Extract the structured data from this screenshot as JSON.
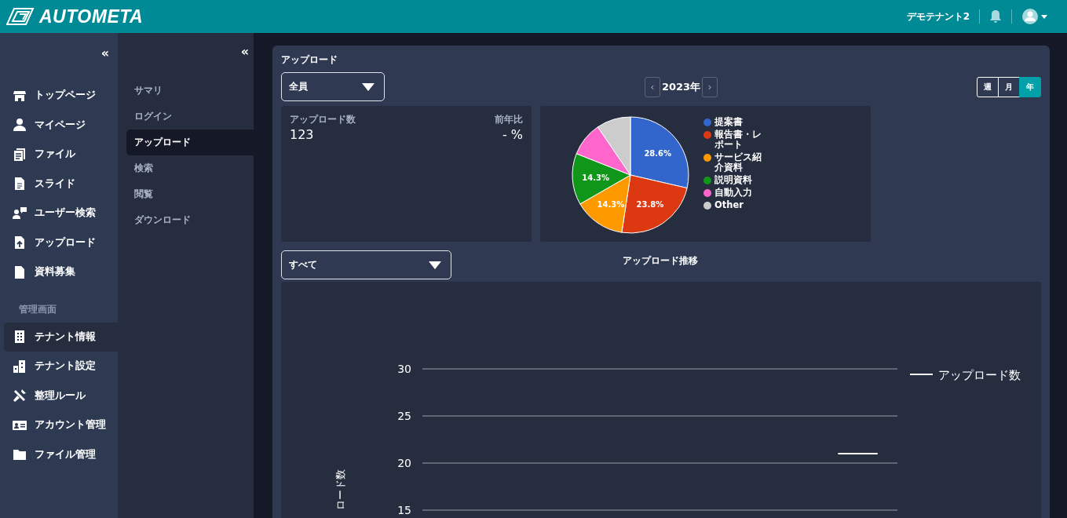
{
  "header": {
    "logo_text": "AUTOMETA",
    "tenant": "デモテナント2"
  },
  "sidebar": {
    "collapse": "«",
    "items": [
      {
        "label": "トップページ",
        "kind": "store",
        "selected": false
      },
      {
        "label": "マイページ",
        "kind": "person",
        "selected": false
      },
      {
        "label": "ファイル",
        "kind": "files",
        "selected": false
      },
      {
        "label": "スライド",
        "kind": "document",
        "selected": false
      },
      {
        "label": "ユーザー検索",
        "kind": "user-chat",
        "selected": false
      },
      {
        "label": "アップロード",
        "kind": "upload",
        "selected": false
      },
      {
        "label": "資料募集",
        "kind": "page",
        "selected": false
      }
    ],
    "section_label": "管理画面",
    "admin_items": [
      {
        "label": "テナント情報",
        "kind": "building",
        "selected": true
      },
      {
        "label": "テナント設定",
        "kind": "buildings",
        "selected": false
      },
      {
        "label": "整理ルール",
        "kind": "tools",
        "selected": false
      },
      {
        "label": "アカウント管理",
        "kind": "idcard",
        "selected": false
      },
      {
        "label": "ファイル管理",
        "kind": "folder",
        "selected": false
      }
    ]
  },
  "subnav": {
    "collapse": "«",
    "items": [
      {
        "label": "サマリ",
        "selected": false
      },
      {
        "label": "ログイン",
        "selected": false
      },
      {
        "label": "アップロード",
        "selected": true
      },
      {
        "label": "検索",
        "selected": false
      },
      {
        "label": "閲覧",
        "selected": false
      },
      {
        "label": "ダウンロード",
        "selected": false
      }
    ]
  },
  "panel": {
    "title": "アップロード",
    "user_select": {
      "value": "全員"
    },
    "year_nav": {
      "prev": "‹",
      "label": "2023年",
      "next": "›"
    },
    "periods": [
      {
        "label": "週",
        "selected": false
      },
      {
        "label": "月",
        "selected": false
      },
      {
        "label": "年",
        "selected": true
      }
    ],
    "stats": {
      "label": "アップロード数",
      "value": "123",
      "change_label": "前年比",
      "change_value": "- %"
    },
    "pie": {
      "chart_data": {
        "type": "pie",
        "categories": [
          "提案書",
          "報告書・レポート",
          "サービス紹介資料",
          "説明資料",
          "自動入力",
          "Other"
        ],
        "values": [
          28.6,
          23.8,
          14.3,
          14.3,
          9.5,
          9.5
        ],
        "colors": [
          "#3366cc",
          "#dc3912",
          "#ff9900",
          "#109618",
          "#ff66cc",
          "#cccccc"
        ],
        "value_labels": [
          "28.6%",
          "23.8%",
          "14.3%",
          "14.3%",
          null,
          null
        ]
      }
    },
    "category_select": {
      "value": "すべて"
    },
    "trend": {
      "title": "アップロード推移",
      "chart_data": {
        "type": "line",
        "ylabel": "ロード数",
        "grid": true,
        "ylim": [
          15,
          30
        ],
        "series": [
          {
            "name": "アップロード数",
            "color": "#ffffff",
            "values": [
              null,
              null,
              null,
              null,
              null,
              null,
              null,
              null,
              null,
              null,
              21,
              21
            ]
          }
        ],
        "yticks": [
          15,
          20,
          25,
          30
        ]
      }
    }
  }
}
